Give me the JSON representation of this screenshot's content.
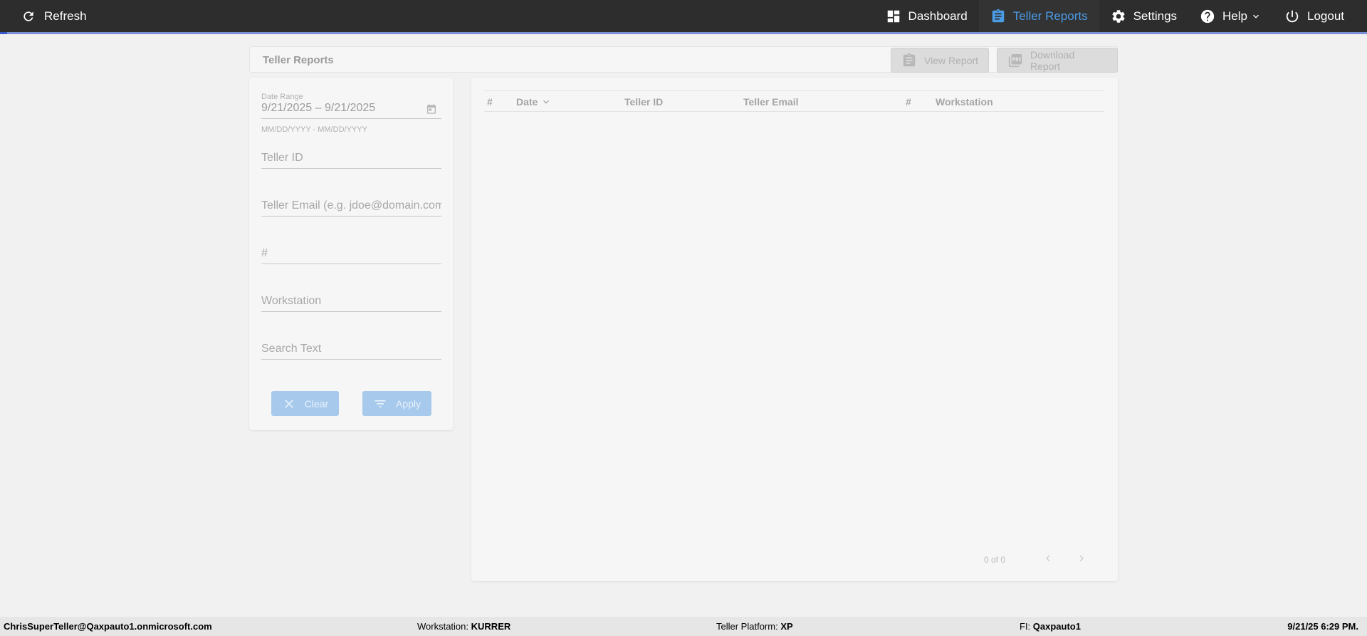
{
  "topbar": {
    "refresh_label": "Refresh",
    "nav": [
      {
        "label": "Dashboard"
      },
      {
        "label": "Teller Reports"
      },
      {
        "label": "Settings"
      },
      {
        "label": "Help"
      },
      {
        "label": "Logout"
      }
    ],
    "active_color": "#4a9be6"
  },
  "header": {
    "title": "Teller Reports",
    "view_report_label": "View Report",
    "download_report_label": "Download Report"
  },
  "filters": {
    "date_range_label": "Date Range",
    "date_range_value": "9/21/2025 – 9/21/2025",
    "date_format_hint": "MM/DD/YYYY - MM/DD/YYYY",
    "teller_id_placeholder": "Teller ID",
    "teller_email_placeholder": "Teller Email (e.g. jdoe@domain.com)",
    "number_placeholder": "#",
    "workstation_placeholder": "Workstation",
    "search_text_placeholder": "Search Text",
    "clear_label": "Clear",
    "apply_label": "Apply",
    "button_color": "#a7c9ec"
  },
  "table": {
    "columns": [
      "#",
      "Date",
      "Teller ID",
      "Teller Email",
      "#",
      "Workstation"
    ],
    "pager_text": "0 of 0"
  },
  "status_bar": {
    "user": "ChrisSuperTeller@Qaxpauto1.onmicrosoft.com",
    "workstation_label": "Workstation:",
    "workstation_value": "KURRER",
    "platform_label": "Teller Platform:",
    "platform_value": "XP",
    "fi_label": "FI:",
    "fi_value": "Qaxpauto1",
    "datetime": "9/21/25 6:29 PM."
  }
}
